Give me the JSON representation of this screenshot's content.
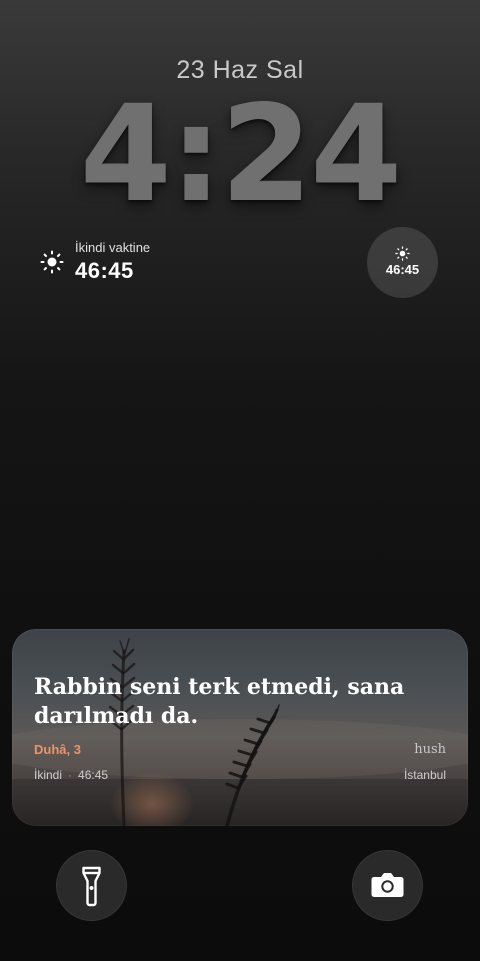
{
  "lockscreen": {
    "date": "23 Haz Sal",
    "time": "4:24"
  },
  "prayer_widget": {
    "icon": "sun-icon",
    "label": "İkindi vaktine",
    "countdown": "46:45"
  },
  "circle_widget": {
    "icon": "sun-icon",
    "countdown": "46:45"
  },
  "notification": {
    "quote": "Rabbin seni terk etmedi, sana darılmadı da.",
    "source": "Duhâ, 3",
    "brand": "hush",
    "prayer": "İkindi",
    "separator": "·",
    "countdown": "46:45",
    "city": "İstanbul",
    "accent_color": "#e8956a"
  },
  "quick_actions": {
    "flashlight_icon": "flashlight-icon",
    "camera_icon": "camera-icon"
  }
}
